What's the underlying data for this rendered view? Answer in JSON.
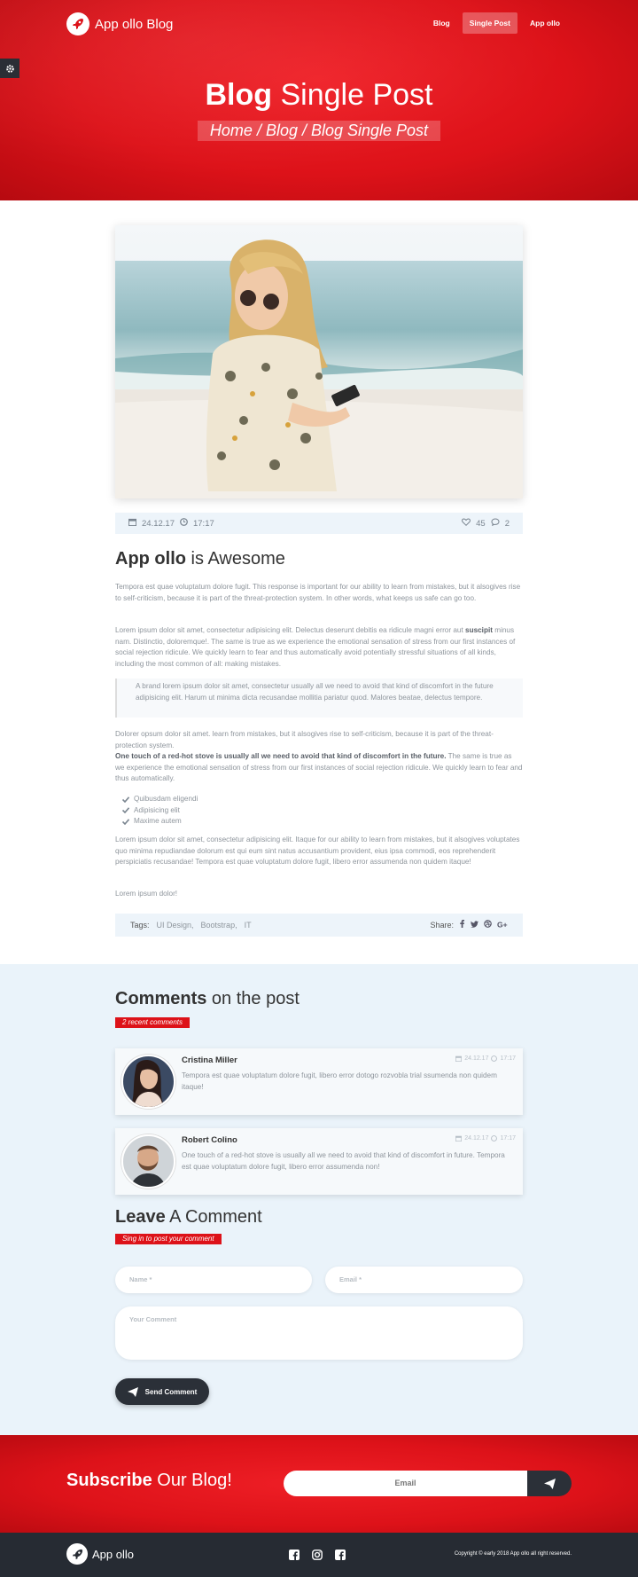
{
  "header": {
    "brand": "App ollo Blog",
    "nav": [
      {
        "label": "Blog",
        "active": false
      },
      {
        "label": "Single Post",
        "active": true
      },
      {
        "label": "App ollo",
        "active": false
      }
    ],
    "title_bold": "Blog",
    "title_rest": "Single Post",
    "breadcrumb": "Home / Blog / Blog Single Post"
  },
  "post": {
    "date": "24.12.17",
    "time": "17:17",
    "likes": "45",
    "comments_count": "2",
    "title_bold": "App ollo",
    "title_rest": "is Awesome",
    "p1": "Tempora est quae voluptatum dolore fugit. This response is important for our ability to learn from mistakes, but it alsogives rise to self-criticism, because it is part of the threat-protection system. In other words, what keeps us safe can go too.",
    "p2_a": "Lorem ipsum dolor sit amet, consectetur adipisicing elit. Delectus deserunt debitis ea ridicule magni error aut ",
    "p2_bold": "suscipit",
    "p2_b": " minus nam. Distinctio, doloremque!. The same is true as we experience the emotional sensation of stress from our first instances of social rejection ridicule. We quickly learn to fear and thus automatically avoid potentially stressful situations of all kinds, including the most common of all: making mistakes.",
    "quote": "A brand lorem ipsum dolor sit amet, consectetur usually all we need to avoid that kind of discomfort in the future adipisicing elit. Harum ut minima dicta recusandae mollitia pariatur quod. Malores beatae, delectus tempore.",
    "p3_a": "Dolorer opsum dolor sit amet. learn from mistakes, but it alsogives rise to self-criticism, because it is part of the threat-protection system.",
    "p3_bold": "One touch of a red-hot stove is usually all we need to avoid that kind of discomfort in the future.",
    "p3_b": " The same is true as we experience the emotional sensation of stress from our first instances of social rejection ridicule. We quickly learn to fear and thus automatically.",
    "checklist": [
      "Quibusdam eligendi",
      "Adipisicing elit",
      "Maxime autem"
    ],
    "p4": "Lorem ipsum dolor sit amet, consectetur adipisicing elit. Itaque for our ability to learn from mistakes, but it alsogives voluptates quo minima repudiandae dolorum est qui eum sint natus accusantium provident, eius ipsa commodi, eos reprehenderit perspiciatis recusandae! Tempora est quae voluptatum dolore fugit, libero error assumenda non quidem itaque!",
    "p5": "Lorem ipsum dolor!",
    "tags_label": "Tags:",
    "tags": [
      "UI Design,",
      "Bootstrap,",
      "IT"
    ],
    "share_label": "Share:",
    "share_icons": [
      "facebook-icon",
      "twitter-icon",
      "dribbble-icon",
      "google-plus-icon"
    ]
  },
  "comments": {
    "title_bold": "Comments",
    "title_rest": "on the post",
    "badge": "2 recent comments",
    "items": [
      {
        "name": "Cristina Miller",
        "date": "24.12.17",
        "time": "17:17",
        "text": "Tempora est quae voluptatum dolore fugit, libero error dotogo rozvobla trial ssumenda non quidem itaque!"
      },
      {
        "name": "Robert Colino",
        "date": "24.12.17",
        "time": "17:17",
        "text": "One touch of a red-hot stove is usually all we need to avoid that kind of discomfort in future. Tempora est quae voluptatum dolore fugit, libero error assumenda non!"
      }
    ]
  },
  "leave": {
    "title_bold": "Leave",
    "title_rest": "A Comment",
    "badge": "Sing in to post your comment",
    "name_placeholder": "Name *",
    "email_placeholder": "Email *",
    "comment_placeholder": "Your Comment",
    "send_label": "Send Comment"
  },
  "subscribe": {
    "title_bold": "Subscribe",
    "title_rest": "Our Blog!",
    "email_placeholder": "Email"
  },
  "footer": {
    "brand": "App ollo",
    "copyright": "Copyright © early 2018 App ollo all right reserved."
  },
  "colors": {
    "brand_red": "#dd1219",
    "dark": "#2b3038",
    "light_blue": "#eaf3fa"
  }
}
